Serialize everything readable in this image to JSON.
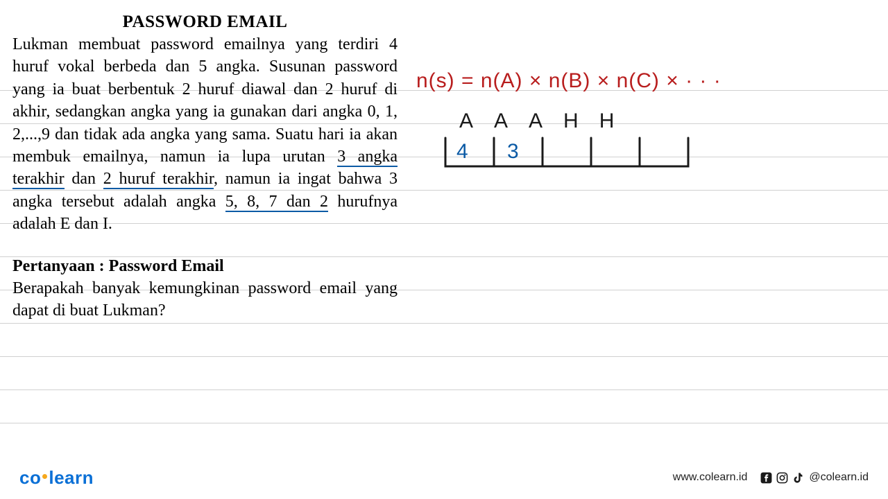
{
  "problem": {
    "title": "PASSWORD EMAIL",
    "para_before_u1": "Lukman membuat password emailnya yang terdiri 4 huruf vokal berbeda dan 5 angka. Susunan password yang ia buat berbentuk 2 huruf diawal dan 2 huruf di akhir, sedangkan angka yang ia gunakan dari angka 0, 1, 2,...,9 dan tidak ada angka yang sama. Suatu hari ia akan membuk emailnya, namun ia lupa urutan ",
    "u1": "3 angka terakhir",
    "mid1": " dan ",
    "u2": "2 huruf terakhir",
    "mid2": ", namun ia ingat bahwa 3 angka tersebut adalah angka ",
    "u3": "5, 8, 7 dan 2",
    "after_u3": " hurufnya adalah E dan I.",
    "q_label": "Pertanyaan",
    "q_sep": " : ",
    "q_title": "Password Email",
    "q_body": "Berapakah banyak kemungkinan password email yang dapat di buat Lukman?"
  },
  "handwriting": {
    "formula": "n(s) = n(A) × n(B) × n(C) × · · ·",
    "lettersA": "A",
    "lettersH": "H",
    "num1": "4",
    "num2": "3"
  },
  "footer": {
    "logo_left": "co",
    "logo_right": "learn",
    "url": "www.colearn.id",
    "handle": "@colearn.id"
  }
}
